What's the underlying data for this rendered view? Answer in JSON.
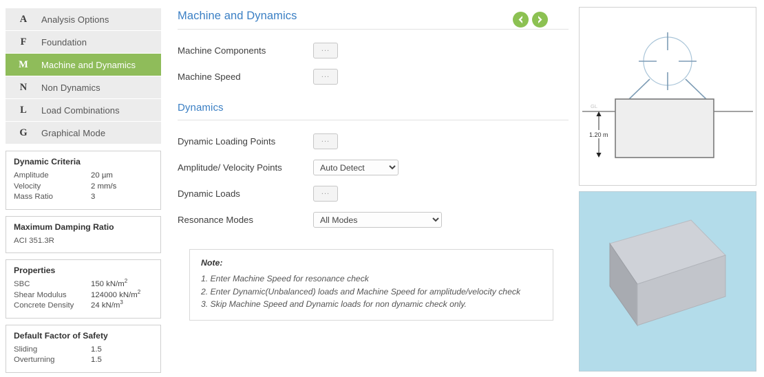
{
  "sidebar": {
    "nav_items": [
      {
        "key": "A",
        "label": "Analysis Options",
        "active": false
      },
      {
        "key": "F",
        "label": "Foundation",
        "active": false
      },
      {
        "key": "M",
        "label": "Machine and Dynamics",
        "active": true
      },
      {
        "key": "N",
        "label": "Non Dynamics",
        "active": false
      },
      {
        "key": "L",
        "label": "Load Combinations",
        "active": false
      },
      {
        "key": "G",
        "label": "Graphical Mode",
        "active": false
      }
    ],
    "cards": {
      "dynamic_criteria": {
        "title": "Dynamic Criteria",
        "rows": [
          {
            "key": "Amplitude",
            "value": "20 µm"
          },
          {
            "key": "Velocity",
            "value": "2 mm/s"
          },
          {
            "key": "Mass Ratio",
            "value": "3"
          }
        ]
      },
      "max_damping_ratio": {
        "title": "Maximum Damping Ratio",
        "value": "ACI 351.3R"
      },
      "properties": {
        "title": "Properties",
        "rows": [
          {
            "key": "SBC",
            "value": "150 kN/m",
            "sup": "2"
          },
          {
            "key": "Shear Modulus",
            "value": "124000 kN/m",
            "sup": "2"
          },
          {
            "key": "Concrete Density",
            "value": "24 kN/m",
            "sup": "3"
          }
        ]
      },
      "default_factor_of_safety": {
        "title": "Default Factor of Safety",
        "rows": [
          {
            "key": "Sliding",
            "value": "1.5"
          },
          {
            "key": "Overturning",
            "value": "1.5"
          }
        ]
      }
    }
  },
  "main": {
    "header": {
      "title": "Machine and Dynamics",
      "prev_icon": "arrow-left-icon",
      "next_icon": "arrow-right-icon"
    },
    "machine_section": {
      "rows": [
        {
          "label": "Machine Components",
          "control": "ellipsis-button",
          "value": "..."
        },
        {
          "label": "Machine Speed",
          "control": "ellipsis-button",
          "value": "..."
        }
      ]
    },
    "dynamics_section": {
      "title": "Dynamics",
      "rows": [
        {
          "label": "Dynamic Loading Points",
          "control": "ellipsis-button",
          "value": "..."
        },
        {
          "label": "Amplitude/ Velocity Points",
          "control": "select",
          "value": "Auto Detect"
        },
        {
          "label": "Dynamic Loads",
          "control": "ellipsis-button",
          "value": "..."
        },
        {
          "label": "Resonance Modes",
          "control": "select",
          "value": "All Modes"
        }
      ]
    },
    "note": {
      "title": "Note:",
      "lines": [
        "1. Enter Machine Speed for resonance check",
        "2. Enter Dynamic(Unbalanced) loads and Machine Speed for amplitude/velocity check",
        "3. Skip Machine Speed and Dynamic loads for non dynamic check only."
      ]
    }
  },
  "diagram": {
    "name": "foundation-elevation-diagram",
    "ground_label": "GL",
    "depth_label": "1.20 m"
  },
  "render": {
    "name": "foundation-3d-view",
    "background_color": "#b3dcea"
  },
  "colors": {
    "accent_green": "#8fbc5a",
    "arrow_green": "#8cc152",
    "heading_blue": "#3a7fc4",
    "sidebar_item_bg": "#ececec",
    "render_bg": "#b3dcea"
  }
}
